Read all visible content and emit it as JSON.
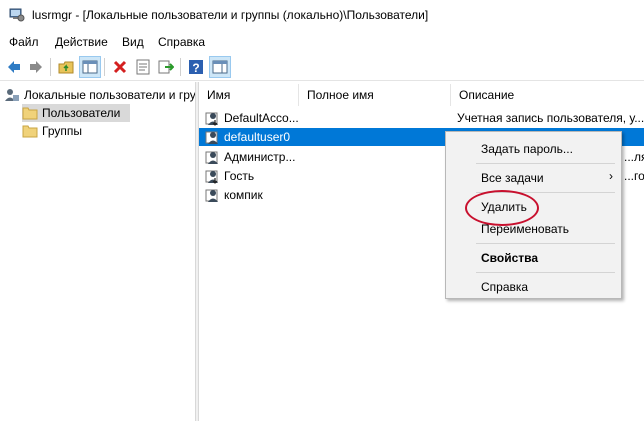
{
  "window": {
    "title": "lusrmgr - [Локальные пользователи и группы (локально)\\Пользователи]"
  },
  "menu": [
    "Файл",
    "Действие",
    "Вид",
    "Справка"
  ],
  "toolbar": {
    "buttons": [
      "back-icon",
      "forward-icon",
      "up-folder-icon",
      "show-tree-icon",
      "delete-icon",
      "properties-icon",
      "export-icon",
      "help-icon",
      "show-pane-icon"
    ]
  },
  "tree": {
    "root": "Локальные пользователи и группы (локально)",
    "items": [
      "Пользователи",
      "Группы"
    ]
  },
  "list": {
    "columns": [
      "Имя",
      "Полное имя",
      "Описание"
    ],
    "rows": [
      {
        "name": "DefaultAcco...",
        "desc": "Учетная запись пользователя, у..."
      },
      {
        "name": "defaultuser0",
        "desc": ""
      },
      {
        "name": "Администр...",
        "desc": "...ля ад..."
      },
      {
        "name": "Гость",
        "desc": "...го до..."
      },
      {
        "name": "компик",
        "desc": ""
      }
    ]
  },
  "context_menu": {
    "items": [
      "Задать пароль...",
      "Все задачи",
      "Удалить",
      "Переименовать",
      "Свойства",
      "Справка"
    ],
    "submenu_arrow": "›"
  },
  "colors": {
    "selection": "#0078d7",
    "annotation": "#c8102e"
  }
}
